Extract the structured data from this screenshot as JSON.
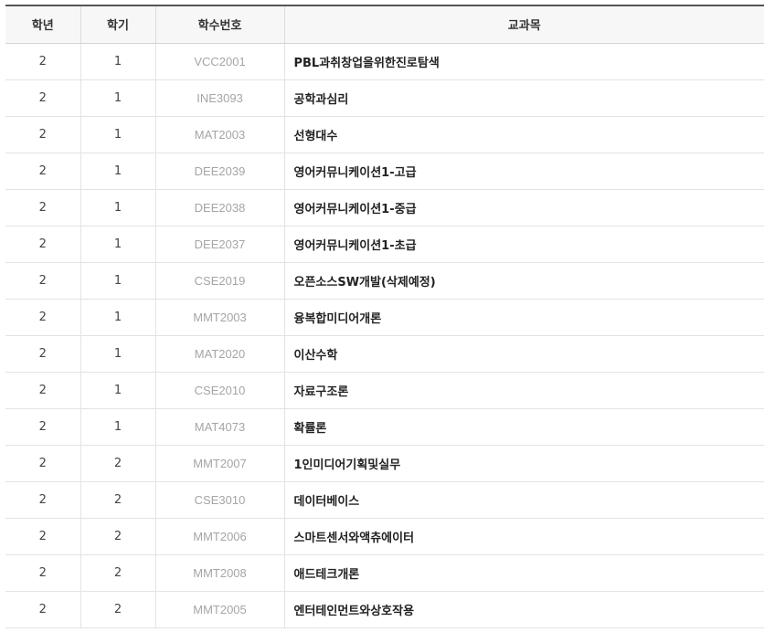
{
  "table": {
    "headers": {
      "grade": "학년",
      "semester": "학기",
      "code": "학수번호",
      "course": "교과목"
    },
    "rows": [
      {
        "grade": "2",
        "semester": "1",
        "code": "VCC2001",
        "course": "PBL과취창업을위한진로탐색"
      },
      {
        "grade": "2",
        "semester": "1",
        "code": "INE3093",
        "course": "공학과심리"
      },
      {
        "grade": "2",
        "semester": "1",
        "code": "MAT2003",
        "course": "선형대수"
      },
      {
        "grade": "2",
        "semester": "1",
        "code": "DEE2039",
        "course": "영어커뮤니케이션1-고급"
      },
      {
        "grade": "2",
        "semester": "1",
        "code": "DEE2038",
        "course": "영어커뮤니케이션1-중급"
      },
      {
        "grade": "2",
        "semester": "1",
        "code": "DEE2037",
        "course": "영어커뮤니케이션1-초급"
      },
      {
        "grade": "2",
        "semester": "1",
        "code": "CSE2019",
        "course": "오픈소스SW개발(삭제예정)"
      },
      {
        "grade": "2",
        "semester": "1",
        "code": "MMT2003",
        "course": "융복합미디어개론"
      },
      {
        "grade": "2",
        "semester": "1",
        "code": "MAT2020",
        "course": "이산수학"
      },
      {
        "grade": "2",
        "semester": "1",
        "code": "CSE2010",
        "course": "자료구조론"
      },
      {
        "grade": "2",
        "semester": "1",
        "code": "MAT4073",
        "course": "확률론"
      },
      {
        "grade": "2",
        "semester": "2",
        "code": "MMT2007",
        "course": "1인미디어기획및실무"
      },
      {
        "grade": "2",
        "semester": "2",
        "code": "CSE3010",
        "course": "데이터베이스"
      },
      {
        "grade": "2",
        "semester": "2",
        "code": "MMT2006",
        "course": "스마트센서와액츄에이터"
      },
      {
        "grade": "2",
        "semester": "2",
        "code": "MMT2008",
        "course": "애드테크개론"
      },
      {
        "grade": "2",
        "semester": "2",
        "code": "MMT2005",
        "course": "엔터테인먼트와상호작용"
      }
    ]
  }
}
